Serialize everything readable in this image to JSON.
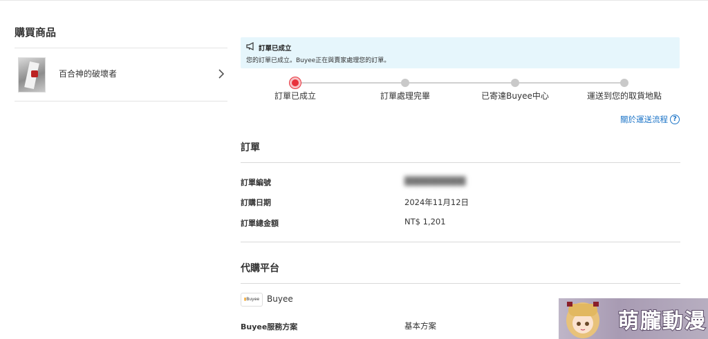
{
  "left": {
    "section_title": "購買商品",
    "product": {
      "name": "百合神的破壞者"
    }
  },
  "notice": {
    "title": "訂單已成立",
    "text": "您的訂單已成立。Buyee正在與賣家處理您的訂單。"
  },
  "progress": {
    "current_step": 1,
    "steps": [
      {
        "label": "訂單已成立"
      },
      {
        "label": "訂單處理完畢"
      },
      {
        "label": "已寄達Buyee中心"
      },
      {
        "label": "運送到您的取貨地點"
      }
    ],
    "active_color": "#e8323c"
  },
  "flow_link": "關於運送流程",
  "order": {
    "title": "訂單",
    "number_label": "訂單編號",
    "number_value": "██████████",
    "date_label": "訂購日期",
    "date_value": "2024年11月12日",
    "total_label": "訂單總金額",
    "total_value": "NT$ 1,201"
  },
  "platform": {
    "title": "代購平台",
    "logo_text": "Buyee",
    "name": "Buyee",
    "plan_label": "Buyee服務方案",
    "plan_value": "基本方案"
  },
  "watermark": {
    "text": "萌朧動漫"
  },
  "colors": {
    "link": "#1a73c7",
    "notice_bg": "#e6f6fc"
  }
}
